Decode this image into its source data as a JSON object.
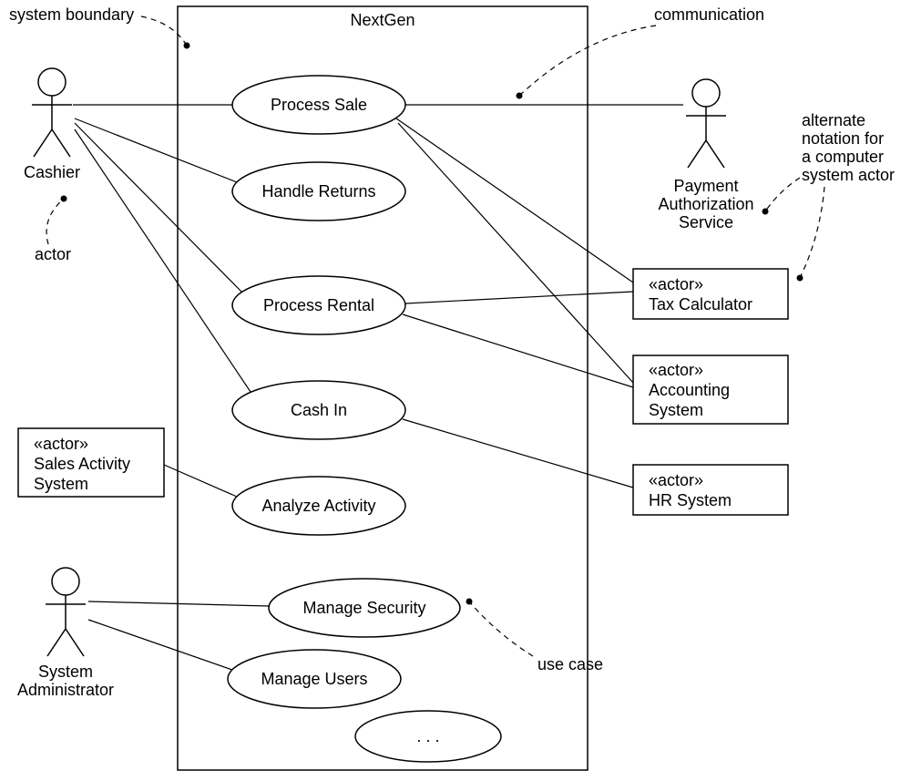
{
  "system": {
    "title": "NextGen"
  },
  "actors": {
    "cashier": "Cashier",
    "sysadmin_line1": "System",
    "sysadmin_line2": "Administrator",
    "pas_line1": "Payment",
    "pas_line2": "Authorization",
    "pas_line3": "Service"
  },
  "box_actors": {
    "stereotype": "«actor»",
    "tax": "Tax Calculator",
    "acct_line1": "Accounting",
    "acct_line2": "System",
    "hr": "HR System",
    "sas_line1": "Sales Activity",
    "sas_line2": "System"
  },
  "usecases": {
    "process_sale": "Process Sale",
    "handle_returns": "Handle Returns",
    "process_rental": "Process Rental",
    "cash_in": "Cash In",
    "analyze_activity": "Analyze Activity",
    "manage_security": "Manage Security",
    "manage_users": "Manage Users",
    "more": ". . ."
  },
  "annotations": {
    "system_boundary": "system boundary",
    "communication": "communication",
    "actor": "actor",
    "use_case": "use case",
    "alt1": "alternate",
    "alt2": "notation for",
    "alt3": "a computer",
    "alt4": "system actor"
  },
  "chart_data": {
    "type": "uml-use-case-diagram",
    "system_boundary": "NextGen",
    "actors": [
      {
        "id": "cashier",
        "name": "Cashier",
        "kind": "human",
        "side": "left"
      },
      {
        "id": "sysadmin",
        "name": "System Administrator",
        "kind": "human",
        "side": "left"
      },
      {
        "id": "sas",
        "name": "Sales Activity System",
        "kind": "system-box",
        "side": "left"
      },
      {
        "id": "pas",
        "name": "Payment Authorization Service",
        "kind": "human",
        "side": "right"
      },
      {
        "id": "tax",
        "name": "Tax Calculator",
        "kind": "system-box",
        "side": "right"
      },
      {
        "id": "acct",
        "name": "Accounting System",
        "kind": "system-box",
        "side": "right"
      },
      {
        "id": "hr",
        "name": "HR System",
        "kind": "system-box",
        "side": "right"
      }
    ],
    "use_cases": [
      "Process Sale",
      "Handle Returns",
      "Process Rental",
      "Cash In",
      "Analyze Activity",
      "Manage Security",
      "Manage Users",
      "..."
    ],
    "associations": [
      [
        "cashier",
        "Process Sale"
      ],
      [
        "cashier",
        "Handle Returns"
      ],
      [
        "cashier",
        "Process Rental"
      ],
      [
        "cashier",
        "Cash In"
      ],
      [
        "pas",
        "Process Sale"
      ],
      [
        "tax",
        "Process Sale"
      ],
      [
        "acct",
        "Process Sale"
      ],
      [
        "tax",
        "Process Rental"
      ],
      [
        "acct",
        "Process Rental"
      ],
      [
        "hr",
        "Cash In"
      ],
      [
        "sas",
        "Analyze Activity"
      ],
      [
        "sysadmin",
        "Manage Security"
      ],
      [
        "sysadmin",
        "Manage Users"
      ]
    ],
    "annotations": [
      {
        "text": "system boundary",
        "points_to": "boundary"
      },
      {
        "text": "communication",
        "points_to": "association(pas, Process Sale)"
      },
      {
        "text": "actor",
        "points_to": "cashier"
      },
      {
        "text": "use case",
        "points_to": "Manage Security"
      },
      {
        "text": "alternate notation for a computer system actor",
        "points_to": [
          "pas",
          "tax"
        ]
      }
    ]
  }
}
